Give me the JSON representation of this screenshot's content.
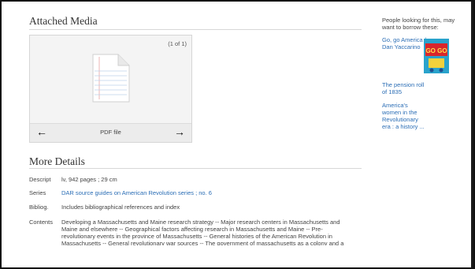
{
  "attached_media": {
    "title": "Attached Media",
    "counter": "(1 of 1)",
    "file_type": "PDF file",
    "prev_arrow": "←",
    "next_arrow": "→"
  },
  "more_details": {
    "title": "More Details",
    "descript": {
      "label": "Descript",
      "value": "lv, 942 pages ; 29 cm"
    },
    "series": {
      "label": "Series",
      "value": "DAR source guides on American Revolution series ; no. 6"
    },
    "bibliog": {
      "label": "Bibliog.",
      "value": "Includes bibliographical references and index"
    },
    "contents": {
      "label": "Contents",
      "value": "Developing a Massachusetts and Maine research strategy -- Major research centers in Massachusetts and Maine and elsewhere -- Geographical factors affecting research in Massachusetts and Maine -- Pre-revolutionary events in the province of Massachusetts -- General histories of the American Revolution in Massachusetts -- General revolutionary war sources -- The government of massachusetts as a colony and a state -- Massachusetts finances and trading during the Revolutionary era -- Massachusetts land records -- Massachusetts military records -- Spies"
    }
  },
  "sidebar": {
    "heading": "People looking for this, may want to borrow these:",
    "items": [
      {
        "title": "Go, go America / Dan Yaccarino"
      },
      {
        "title": "The pension roll of 1835"
      },
      {
        "title": "America's women in the Revolutionary era : a history ..."
      }
    ],
    "cover_text": "GO GO"
  }
}
